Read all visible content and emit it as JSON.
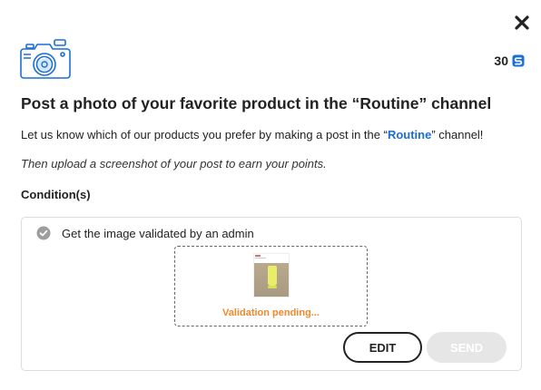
{
  "header": {
    "close_icon": "close-icon",
    "illustration_icon": "camera-icon",
    "points": "30",
    "points_icon": "coin-icon",
    "accent_color": "#1a6fd6"
  },
  "challenge": {
    "title": "Post a photo of your favorite product in the “Routine” channel",
    "description_before": "Let us know which of our products you prefer by making a post in the “",
    "channel_name": "Routine",
    "description_after": "” channel!",
    "instruction": "Then upload a screenshot of your post to earn your points."
  },
  "conditions": {
    "heading": "Condition(s)",
    "items": [
      {
        "text": "Get the image validated by an admin",
        "icon": "check-circle-icon",
        "status_text": "Validation pending...",
        "status_color": "#f0882e"
      }
    ]
  },
  "actions": {
    "edit_label": "EDIT",
    "send_label": "SEND",
    "send_disabled": true
  }
}
